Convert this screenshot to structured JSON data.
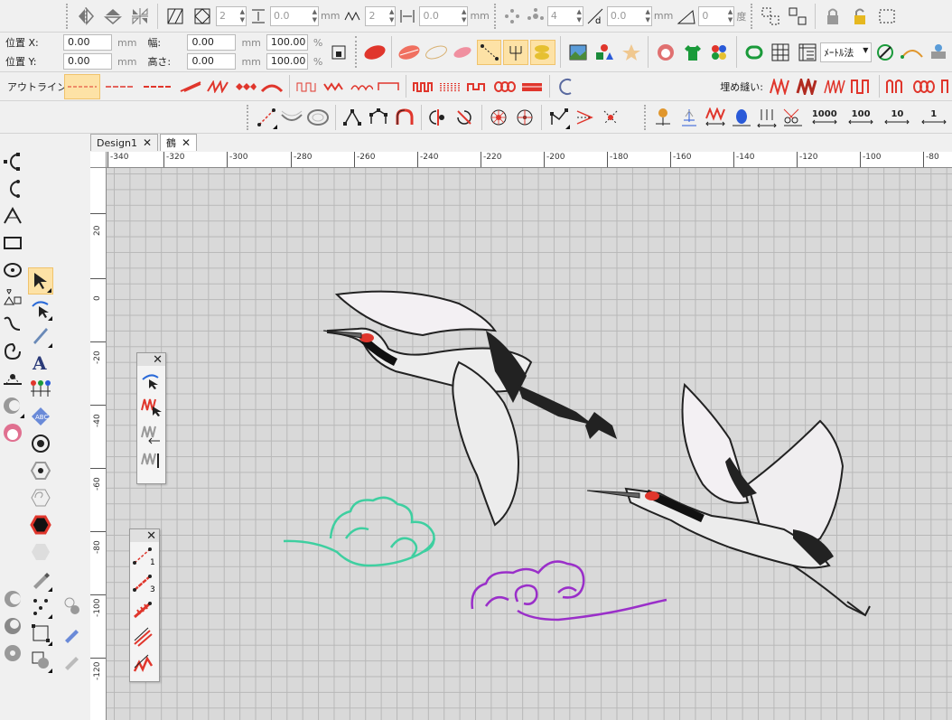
{
  "toolbar1": {
    "spin_count_a": "2",
    "spin_offset_a": "0.0",
    "unit_a": "mm",
    "spin_count_b": "2",
    "spin_offset_b": "0.0",
    "unit_b": "mm",
    "spin_count_c": "4",
    "spin_offset_c": "0.0",
    "unit_c": "mm",
    "spin_angle": "0",
    "unit_angle": "度"
  },
  "position": {
    "x_label": "位置 X:",
    "y_label": "位置 Y:",
    "x_value": "0.00",
    "y_value": "0.00",
    "unit": "mm",
    "width_label": "幅:",
    "height_label": "高さ:",
    "width_value": "0.00",
    "height_value": "0.00",
    "width_pct": "100.00",
    "height_pct": "100.00",
    "pct_unit": "%"
  },
  "measure": {
    "selected": "ﾒｰﾄﾙ法"
  },
  "outline_label": "アウトライン:",
  "fill_label": "埋め縫い:",
  "fill_counts": [
    "1000",
    "100",
    "10",
    "1"
  ],
  "tabs": [
    {
      "label": "Design1"
    },
    {
      "label": "鶴"
    }
  ],
  "ruler": {
    "h_ticks": [
      "-340",
      "-320",
      "-300",
      "-280",
      "-260",
      "-240",
      "-220",
      "-200",
      "-180",
      "-160",
      "-140",
      "-120",
      "-100",
      "-80"
    ],
    "v_ticks": [
      "20",
      "0",
      "-20",
      "-40",
      "-60",
      "-80",
      "-100",
      "-120"
    ]
  },
  "palette_seq_labels": [
    "1",
    "3"
  ],
  "colors": {
    "accent_red": "#e0362c",
    "selected_bg": "#fde2a6",
    "grid_bg": "#d9d9d9",
    "cloud_teal": "#3ecfa0",
    "cloud_purple": "#9a2fc9"
  }
}
